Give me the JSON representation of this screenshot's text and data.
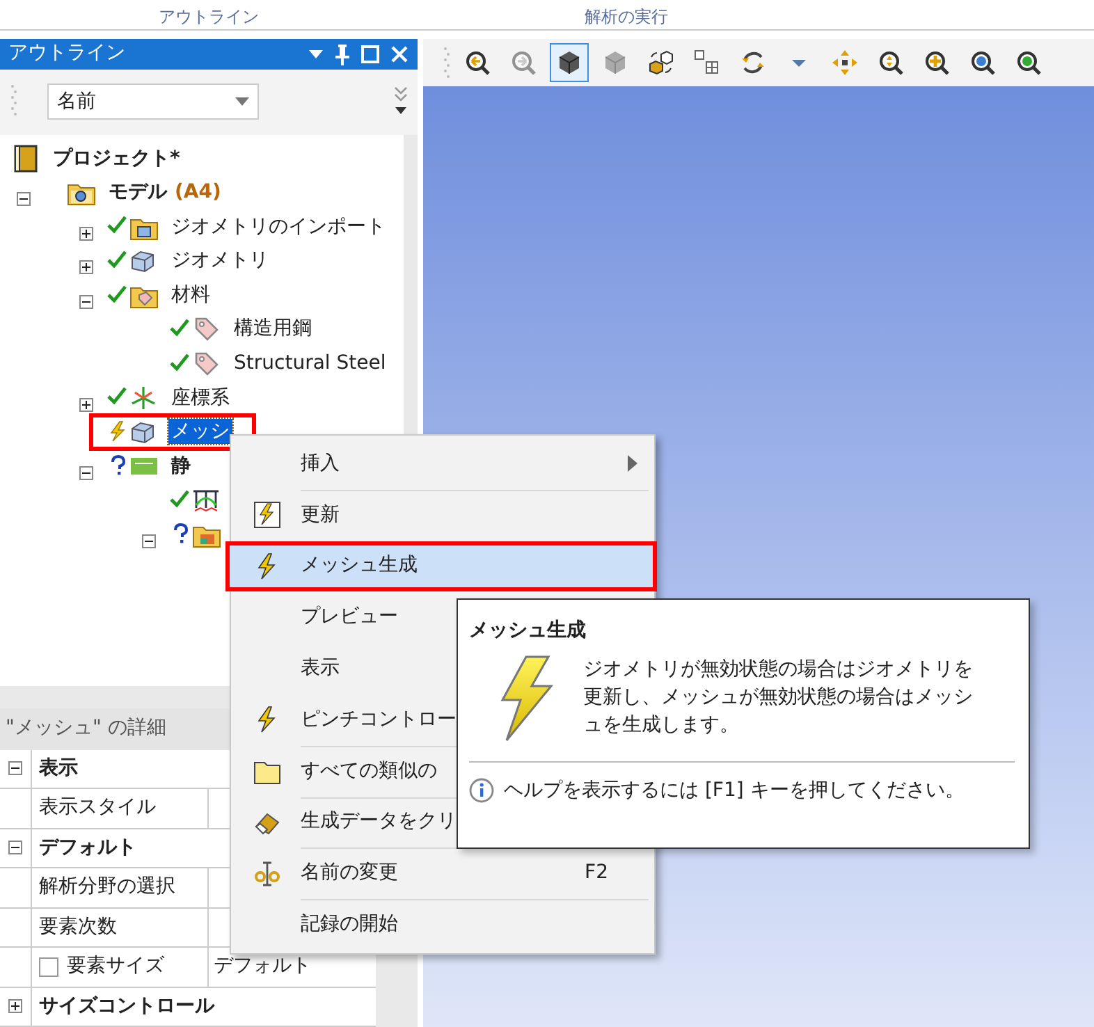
{
  "ribbon": {
    "tabs": [
      {
        "label": "アウトライン"
      },
      {
        "label": "解析の実行"
      }
    ]
  },
  "outline": {
    "title": "アウトライン",
    "filter": {
      "value": "名前"
    },
    "tree": [
      {
        "label": "プロジェクト*",
        "kind": "project",
        "selected": false,
        "children": [
          {
            "label": "モデル",
            "tag": "(A4)",
            "kind": "model",
            "expanded": true,
            "selected": false,
            "children": [
              {
                "label": "ジオメトリのインポート",
                "kind": "import",
                "status": {
                  "kind": "ok"
                },
                "expanded": false,
                "selected": false
              },
              {
                "label": "ジオメトリ",
                "kind": "geometry",
                "status": {
                  "kind": "ok"
                },
                "expanded": false,
                "selected": false
              },
              {
                "label": "材料",
                "kind": "materials",
                "status": {
                  "kind": "ok"
                },
                "expanded": true,
                "selected": false,
                "children": [
                  {
                    "label": "構造用鋼",
                    "kind": "material",
                    "status": {
                      "kind": "ok"
                    },
                    "selected": false
                  },
                  {
                    "label": "Structural Steel",
                    "kind": "material",
                    "status": {
                      "kind": "ok"
                    },
                    "selected": false
                  }
                ]
              },
              {
                "label": "座標系",
                "kind": "coordinates",
                "status": {
                  "kind": "ok"
                },
                "expanded": false,
                "selected": false
              },
              {
                "label": "メッシ",
                "kind": "geometry",
                "status": {
                  "kind": "pending"
                },
                "selected": true,
                "framed": true
              },
              {
                "label": "静",
                "kind": "analysis",
                "status": {
                  "kind": "unknown"
                },
                "expanded": true,
                "selected": false,
                "children": [
                  {
                    "kind": "support",
                    "status": {
                      "kind": "ok"
                    },
                    "selected": false
                  },
                  {
                    "kind": "solution",
                    "status": {
                      "kind": "unknown"
                    },
                    "expanded": true,
                    "selected": false
                  }
                ]
              }
            ]
          }
        ]
      }
    ]
  },
  "viewer_toolbar": {
    "buttons": [
      {
        "kind": "zoom-back",
        "selected": false,
        "disabled": false
      },
      {
        "kind": "zoom-forward",
        "selected": false,
        "disabled": true
      },
      {
        "kind": "solid-cube",
        "selected": true,
        "disabled": false
      },
      {
        "kind": "shaded-cube",
        "selected": false,
        "disabled": false
      },
      {
        "kind": "cube-pair",
        "selected": false,
        "disabled": false
      },
      {
        "kind": "layout",
        "selected": false,
        "disabled": false
      },
      {
        "kind": "rotate",
        "selected": false,
        "disabled": false
      },
      {
        "kind": "caret",
        "selected": false,
        "disabled": false
      },
      {
        "kind": "pan",
        "selected": false,
        "disabled": false
      },
      {
        "kind": "zoom-fit",
        "selected": false,
        "disabled": false
      },
      {
        "kind": "zoom-in",
        "selected": false,
        "disabled": false
      },
      {
        "kind": "zoom-box",
        "selected": false,
        "disabled": false
      },
      {
        "kind": "zoom-select",
        "selected": false,
        "disabled": false
      }
    ]
  },
  "details": {
    "title": "\"メッシュ\" の詳細",
    "rows": [
      {
        "kind": "group",
        "label": "表示",
        "expanded": true
      },
      {
        "kind": "property",
        "label": "表示スタイル"
      },
      {
        "kind": "group",
        "label": "デフォルト",
        "expanded": true
      },
      {
        "kind": "property",
        "label": "解析分野の選択"
      },
      {
        "kind": "property",
        "label": "要素次数"
      },
      {
        "kind": "check",
        "label": "要素サイズ",
        "checked": false,
        "value": "デフォルト"
      },
      {
        "kind": "group",
        "label": "サイズコントロール",
        "expanded": false
      }
    ]
  },
  "context_menu": {
    "items": [
      {
        "label": "挿入",
        "kind": "none",
        "submenu": true,
        "separator": false,
        "selected": false
      },
      {
        "label": "更新",
        "kind": "refresh",
        "separator": true,
        "selected": false
      },
      {
        "label": "メッシュ生成",
        "kind": "bolt",
        "separator": false,
        "selected": true,
        "framed": true
      },
      {
        "label": "プレビュー",
        "kind": "none",
        "separator": false,
        "selected": false
      },
      {
        "label": "表示",
        "kind": "none",
        "separator": false,
        "selected": false
      },
      {
        "label": "ピンチコントロー",
        "kind": "bolt",
        "separator": false,
        "selected": false
      },
      {
        "label": "すべての類似の",
        "kind": "folder",
        "separator": true,
        "selected": false
      },
      {
        "label": "生成データをクリ",
        "kind": "eraser",
        "separator": true,
        "selected": false
      },
      {
        "label": "名前の変更",
        "kind": "rename",
        "shortcut": "F2",
        "separator": true,
        "selected": false
      },
      {
        "label": "記録の開始",
        "kind": "none",
        "separator": true,
        "selected": false
      }
    ]
  },
  "tooltip": {
    "title": "メッシュ生成",
    "text": "ジオメトリが無効状態の場合はジオメトリを更新し、メッシュが無効状態の場合はメッシュを生成します。",
    "help": "ヘルプを表示するには [F1] キーを押してください。"
  }
}
